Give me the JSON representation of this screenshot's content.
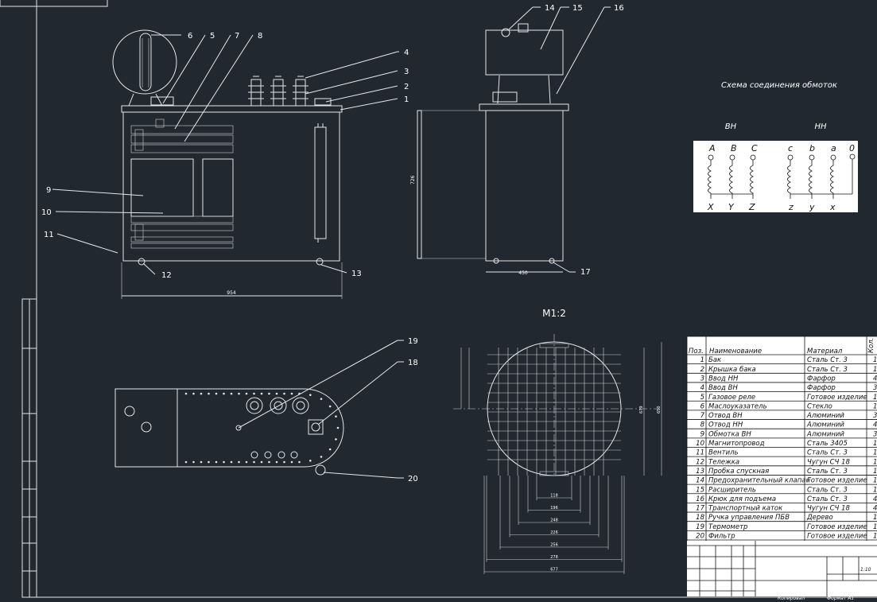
{
  "scale_label": "M1:2",
  "scheme": {
    "title": "Схема соединения обмоток",
    "hv_label": "ВН",
    "lv_label": "НН",
    "hv_top": [
      "A",
      "B",
      "C"
    ],
    "hv_bottom": [
      "X",
      "Y",
      "Z"
    ],
    "lv_top": [
      "c",
      "b",
      "a",
      "0"
    ],
    "lv_bottom": [
      "z",
      "y",
      "x"
    ]
  },
  "callouts": [
    "1",
    "2",
    "3",
    "4",
    "5",
    "6",
    "7",
    "8",
    "9",
    "10",
    "11",
    "12",
    "13",
    "14",
    "15",
    "16",
    "17",
    "18",
    "19",
    "20"
  ],
  "dims": {
    "front_width": "954",
    "side_width": "450",
    "side_height": "726",
    "plan_widths": [
      "118",
      "196",
      "248",
      "226",
      "256",
      "278",
      "677"
    ],
    "plan_heights": [
      "679",
      "650"
    ]
  },
  "bom": {
    "headers": [
      "Поз.",
      "Наименование",
      "Материал",
      "Кол."
    ],
    "rows": [
      [
        "1",
        "Бак",
        "Сталь Ст. 3",
        "1"
      ],
      [
        "2",
        "Крышка бака",
        "Сталь Ст. 3",
        "1"
      ],
      [
        "3",
        "Ввод НН",
        "Фарфор",
        "4"
      ],
      [
        "4",
        "Ввод ВН",
        "Фарфор",
        "3"
      ],
      [
        "5",
        "Газовое реле",
        "Готовое изделие",
        "1"
      ],
      [
        "6",
        "Маслоуказатель",
        "Стекло",
        "1"
      ],
      [
        "7",
        "Отвод ВН",
        "Алюминий",
        "3"
      ],
      [
        "8",
        "Отвод НН",
        "Алюминий",
        "4"
      ],
      [
        "9",
        "Обмотка ВН",
        "Алюминий",
        "3"
      ],
      [
        "10",
        "Магнитопровод",
        "Сталь 3405",
        "1"
      ],
      [
        "11",
        "Вентиль",
        "Сталь Ст. 3",
        "1"
      ],
      [
        "12",
        "Тележка",
        "Чугун СЧ 18",
        "1"
      ],
      [
        "13",
        "Пробка спускная",
        "Сталь Ст. 3",
        "1"
      ],
      [
        "14",
        "Предохранительный клапан",
        "Готовое изделие",
        "1"
      ],
      [
        "15",
        "Расширитель",
        "Сталь Ст. 3",
        "1"
      ],
      [
        "16",
        "Крюк для подъема",
        "Сталь Ст. 3",
        "4"
      ],
      [
        "17",
        "Транспортный каток",
        "Чугун СЧ 18",
        "4"
      ],
      [
        "18",
        "Ручка управления ПБВ",
        "Дерево",
        "1"
      ],
      [
        "19",
        "Термометр",
        "Готовое изделие",
        "1"
      ],
      [
        "20",
        "Фильтр",
        "Готовое изделие",
        "1"
      ]
    ]
  },
  "stamp": {
    "sheet": "1:10",
    "copied": "Копировал",
    "format": "Формат А1"
  },
  "colors": {
    "background": "#212830",
    "lines": "#e6e6e6",
    "table_bg": "#ffffff"
  }
}
